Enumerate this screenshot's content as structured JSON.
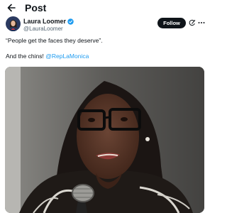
{
  "header": {
    "title": "Post",
    "back_icon": "back-arrow-icon"
  },
  "author": {
    "name": "Laura Loomer",
    "handle": "@LauraLoomer",
    "verified_color": "#1d9bf0",
    "follow_label": "Follow"
  },
  "tweet": {
    "line1": "“People get the faces they deserve”.",
    "line2_prefix": "And the chins! ",
    "line2_mention": "@RepLaMonica",
    "mention_color": "#1d9bf0"
  },
  "media": {
    "kind": "photo"
  }
}
